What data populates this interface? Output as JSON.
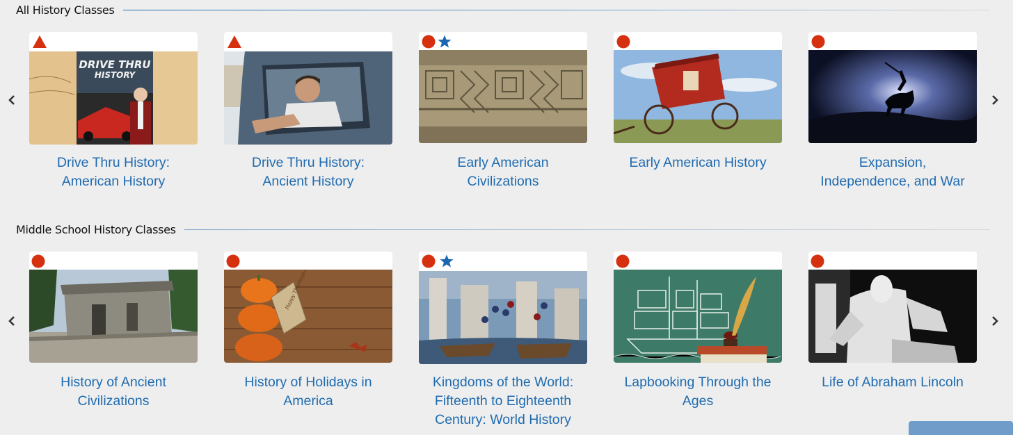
{
  "sections": [
    {
      "title": "All History Classes",
      "cards": [
        {
          "title_lines": [
            "Drive Thru History:",
            "American History"
          ],
          "badges": [
            "triangle"
          ],
          "thumb": "drive-thru-american"
        },
        {
          "title_lines": [
            "Drive Thru History:",
            "Ancient History"
          ],
          "badges": [
            "triangle"
          ],
          "thumb": "drive-thru-ancient"
        },
        {
          "title_lines": [
            "Early American",
            "Civilizations"
          ],
          "badges": [
            "circle",
            "star"
          ],
          "thumb": "maya-ruins"
        },
        {
          "title_lines": [
            "Early American History",
            ""
          ],
          "badges": [
            "circle"
          ],
          "thumb": "stagecoach"
        },
        {
          "title_lines": [
            "Expansion,",
            "Independence, and War"
          ],
          "badges": [
            "circle"
          ],
          "thumb": "horseman"
        }
      ]
    },
    {
      "title": "Middle School History Classes",
      "cards": [
        {
          "title_lines": [
            "History of Ancient",
            "Civilizations"
          ],
          "badges": [
            "circle"
          ],
          "thumb": "stone-ruin"
        },
        {
          "title_lines": [
            "History of Holidays in",
            "America"
          ],
          "badges": [
            "circle"
          ],
          "thumb": "pumpkins"
        },
        {
          "title_lines": [
            "Kingdoms of the World:",
            "Fifteenth to Eighteenth",
            "Century: World History"
          ],
          "badges": [
            "circle",
            "star"
          ],
          "thumb": "medieval-city"
        },
        {
          "title_lines": [
            "Lapbooking Through the",
            "Ages"
          ],
          "badges": [
            "circle"
          ],
          "thumb": "chalk-ship"
        },
        {
          "title_lines": [
            "Life of Abraham Lincoln",
            ""
          ],
          "badges": [
            "circle"
          ],
          "thumb": "lincoln-statue"
        }
      ]
    }
  ],
  "icons": {
    "prev": "chevron-left-icon",
    "next": "chevron-right-icon",
    "triangle": "red-triangle-icon",
    "circle": "red-circle-icon",
    "star": "blue-star-icon"
  },
  "colors": {
    "title_blue": "#1f6bb0",
    "badge_red": "#d5300f",
    "badge_blue": "#1a66b3"
  },
  "thumb_labels": {
    "drive_thru_logo_line1": "DRIVE THRU",
    "drive_thru_logo_line2": "HISTORY",
    "tag_text": "Happy Thanksgiving"
  }
}
